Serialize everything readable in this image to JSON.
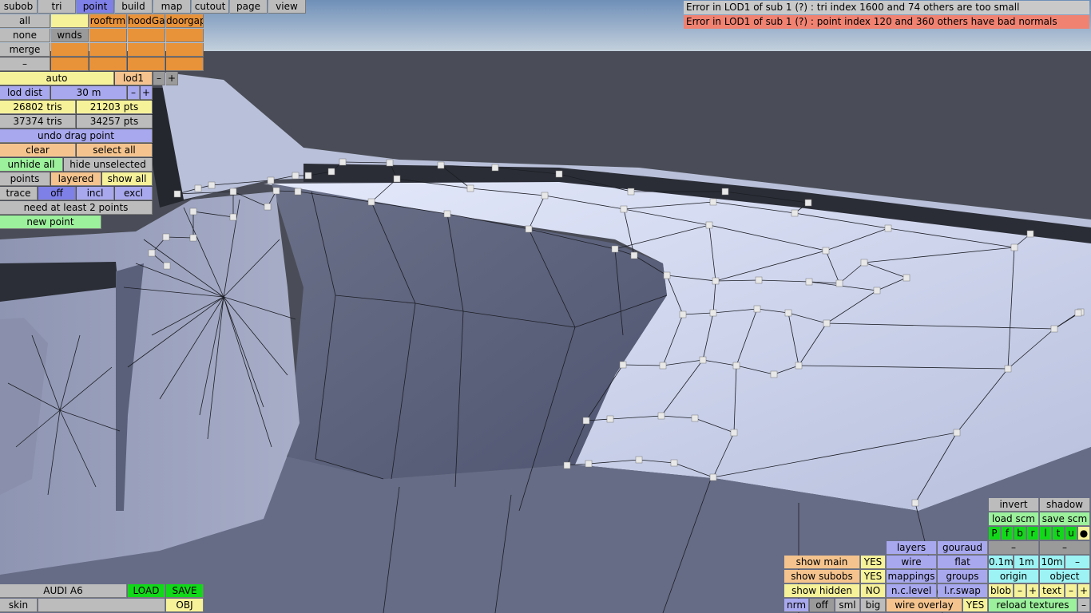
{
  "colors": {
    "sky": "#9fb6cc",
    "ground": "#4a4d57",
    "mesh_light": "#c9d1ec",
    "mesh_dark": "#5a6078",
    "point": "#e4e4e4"
  },
  "tabs": [
    "subob",
    "tri",
    "point",
    "build",
    "map",
    "cutout",
    "page",
    "view"
  ],
  "selection": {
    "all": "all",
    "none": "none",
    "merge": "merge",
    "minus": "–",
    "wnds": "wnds",
    "rooftrm": "rooftrm",
    "hoodGap": "hoodGap",
    "doorgap": "doorgap"
  },
  "lod": {
    "auto": "auto",
    "lod": "lod1",
    "minus": "–",
    "plus": "+",
    "dist_label": "lod dist",
    "dist_value": "30 m"
  },
  "stats": {
    "tris1": "26802 tris",
    "pts1": "21203 pts",
    "tris2": "37374 tris",
    "pts2": "34257 pts"
  },
  "point_tools": {
    "undo": "undo drag point",
    "clear": "clear",
    "select_all": "select all",
    "unhide_all": "unhide all",
    "hide_unselected": "hide unselected",
    "points": "points",
    "layered": "layered",
    "show_all": "show all",
    "trace": "trace",
    "off": "off",
    "incl": "incl",
    "excl": "excl",
    "status": "need at least 2 points",
    "new_point": "new point"
  },
  "errors": [
    "Error in LOD1 of sub 1 (?) : tri index 1600 and 74 others are too small",
    "Error in LOD1 of sub 1 (?) : point index 120 and 360 others have bad normals"
  ],
  "file": {
    "name": "AUDI A6",
    "load": "LOAD",
    "save": "SAVE",
    "skin": "skin",
    "obj": "OBJ"
  },
  "display": {
    "show_main": "show main",
    "show_main_val": "YES",
    "show_subobs": "show subobs",
    "show_subobs_val": "YES",
    "show_hidden": "show hidden",
    "show_hidden_val": "NO",
    "nrm": "nrm",
    "off": "off",
    "sml": "sml",
    "big": "big",
    "layers": "layers",
    "gouraud": "gouraud",
    "wire": "wire",
    "flat": "flat",
    "mappings": "mappings",
    "groups": "groups",
    "ncl": "n.c.level",
    "lrswap": "l.r.swap",
    "wire_overlay": "wire overlay",
    "wire_overlay_val": "YES"
  },
  "view_tools": {
    "invert": "invert",
    "shadow": "shadow",
    "load_scm": "load scm",
    "save_scm": "save scm",
    "flags": [
      "P",
      "f",
      "b",
      "r",
      "l",
      "t",
      "u",
      "●"
    ],
    "dash": "–",
    "step1": "0.1m",
    "step2": "1m",
    "step3": "10m",
    "minus": "–",
    "origin": "origin",
    "object": "object",
    "blob": "blob",
    "text": "text",
    "plus": "+",
    "reload": "reload textures"
  }
}
